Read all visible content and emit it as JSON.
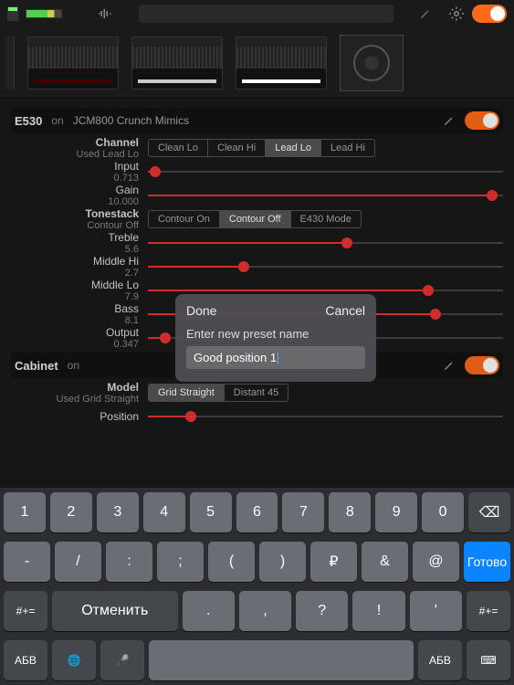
{
  "topbar": {
    "gear": "gear",
    "toggle_on": true
  },
  "section_amp": {
    "name": "E530",
    "state": "on",
    "preset": "JCM800 Crunch Mimics",
    "channel": {
      "label": "Channel",
      "sub": "Used Lead Lo",
      "options": [
        "Clean Lo",
        "Clean Hi",
        "Lead Lo",
        "Lead Hi"
      ],
      "selected": 2
    },
    "params": [
      {
        "label": "Input",
        "value": "0.713",
        "pos": 0.02
      },
      {
        "label": "Gain",
        "value": "10.000",
        "pos": 0.97
      }
    ],
    "tonestack": {
      "label": "Tonestack",
      "sub": "Contour Off",
      "options": [
        "Contour On",
        "Contour Off",
        "E430 Mode"
      ],
      "selected": 1
    },
    "params2": [
      {
        "label": "Treble",
        "value": "5.6",
        "pos": 0.56
      },
      {
        "label": "Middle Hi",
        "value": "2.7",
        "pos": 0.27
      },
      {
        "label": "Middle Lo",
        "value": "7.9",
        "pos": 0.79
      },
      {
        "label": "Bass",
        "value": "8.1",
        "pos": 0.81
      },
      {
        "label": "Output",
        "value": "0.347",
        "pos": 0.05
      }
    ]
  },
  "section_cab": {
    "name": "Cabinet",
    "state": "on",
    "model": {
      "label": "Model",
      "sub": "Used Grid Straight",
      "options": [
        "Grid Straight",
        "Distant 45"
      ],
      "selected": 0
    },
    "position_label": "Position"
  },
  "dialog": {
    "done": "Done",
    "cancel": "Cancel",
    "prompt": "Enter new preset name",
    "value": "Good position 1"
  },
  "keyboard": {
    "row1": [
      "1",
      "2",
      "3",
      "4",
      "5",
      "6",
      "7",
      "8",
      "9",
      "0",
      "⌫"
    ],
    "row2": [
      "-",
      "/",
      ":",
      ";",
      "(",
      ")",
      "₽",
      "&",
      "@",
      "Готово"
    ],
    "row3_left": "#+=",
    "row3_undo": "Отменить",
    "row3_mid": [
      ".",
      ",",
      "?",
      "!",
      "'"
    ],
    "row3_right": "#+=",
    "row4": [
      "АБВ",
      "🌐",
      "🎤",
      "",
      "АБВ",
      "⌨"
    ]
  }
}
